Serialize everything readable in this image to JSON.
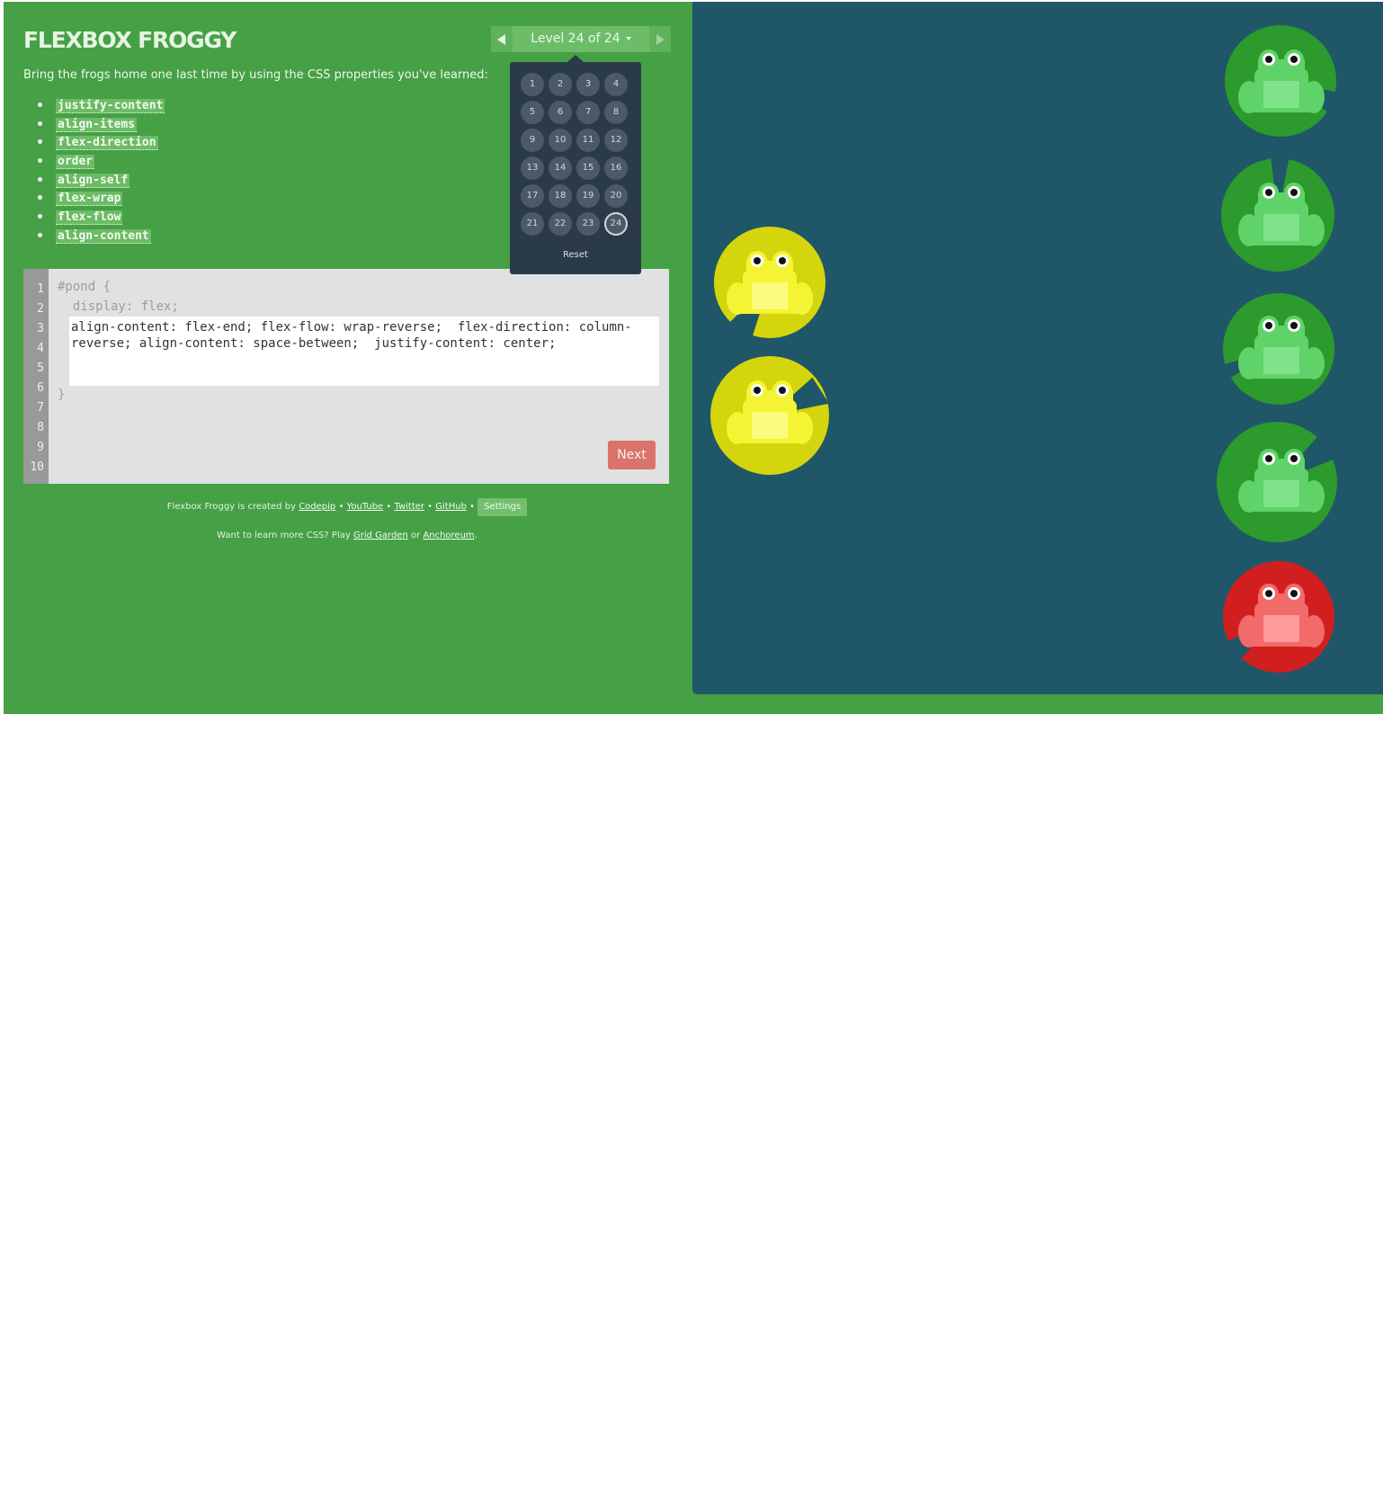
{
  "app": {
    "title": "FLEXBOX FROGGY",
    "level_label": "Level 24 of 24",
    "instructions": "Bring the frogs home one last time by using the CSS properties you've learned:",
    "properties": [
      "justify-content",
      "align-items",
      "flex-direction",
      "order",
      "align-self",
      "flex-wrap",
      "flex-flow",
      "align-content"
    ]
  },
  "levels": {
    "items": [
      "1",
      "2",
      "3",
      "4",
      "5",
      "6",
      "7",
      "8",
      "9",
      "10",
      "11",
      "12",
      "13",
      "14",
      "15",
      "16",
      "17",
      "18",
      "19",
      "20",
      "21",
      "22",
      "23",
      "24"
    ],
    "current": "24",
    "reset_label": "Reset"
  },
  "editor": {
    "line_numbers": [
      "1",
      "2",
      "3",
      "4",
      "5",
      "6",
      "7",
      "8",
      "9",
      "10"
    ],
    "line1": "#pond {",
    "line2": "  display: flex;",
    "input_value": "align-content: flex-end; flex-flow: wrap-reverse;  flex-direction: column-reverse; align-content: space-between;  justify-content: center;",
    "closing": "}",
    "next_label": "Next"
  },
  "footer": {
    "created_by": "Flexbox Froggy is created by",
    "links": [
      "Codepip",
      "YouTube",
      "Twitter",
      "GitHub"
    ],
    "settings_label": "Settings",
    "more_prefix": "Want to learn more CSS? Play",
    "grid_garden": "Grid Garden",
    "or_text": "or",
    "anchoreum": "Anchoreum",
    "period": "."
  },
  "colors": {
    "background": "#46a046",
    "pond": "#1f5768",
    "green": "#2c9a2c",
    "yellow": "#d5d50e",
    "red": "#d11f1f"
  },
  "pond": {
    "lilypads": [
      "green",
      "green",
      "green",
      "green",
      "red"
    ],
    "frogs": [
      "yellow",
      "yellow",
      "green",
      "green",
      "green",
      "green",
      "red"
    ]
  }
}
